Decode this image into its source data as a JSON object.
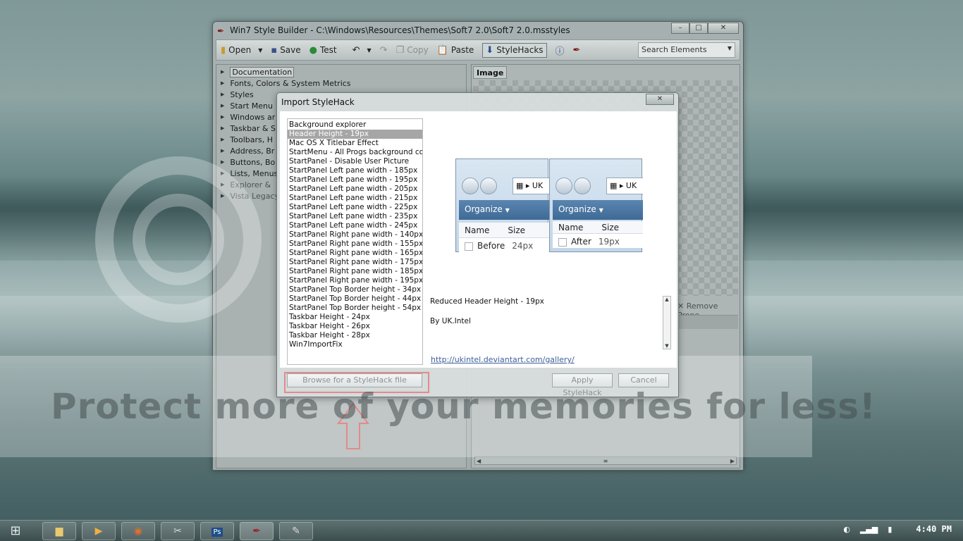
{
  "window": {
    "title": "Win7 Style Builder - C:\\Windows\\Resources\\Themes\\Soft7 2.0\\Soft7 2.0.msstyles",
    "minimize_glyph": "–",
    "maximize_glyph": "□",
    "close_glyph": "✕"
  },
  "toolbar": {
    "open": "Open",
    "save": "Save",
    "test": "Test",
    "copy": "Copy",
    "paste": "Paste",
    "stylehacks": "StyleHacks",
    "search_placeholder": "Search Elements"
  },
  "tree": {
    "items": [
      {
        "label": "Documentation"
      },
      {
        "label": "Fonts, Colors & System Metrics"
      },
      {
        "label": "Styles"
      },
      {
        "label": "Start Menu"
      },
      {
        "label": "Windows ar"
      },
      {
        "label": "Taskbar & S"
      },
      {
        "label": "Toolbars, H"
      },
      {
        "label": "Address, Br"
      },
      {
        "label": "Buttons, Bo"
      },
      {
        "label": "Lists, Menus"
      },
      {
        "label": "Explorer &"
      },
      {
        "label": "Vista Legacy"
      }
    ]
  },
  "right_panel": {
    "tab_label": "Image",
    "remove_property": "Remove Prope"
  },
  "dialog": {
    "title": "Import StyleHack",
    "close_glyph": "✕",
    "hacks": [
      "Background explorer",
      "Header Height - 19px",
      "Mac OS X Titlebar Effect",
      "StartMenu - All Progs background color",
      "StartPanel - Disable User Picture",
      "StartPanel Left pane width - 185px",
      "StartPanel Left pane width - 195px",
      "StartPanel Left pane width - 205px",
      "StartPanel Left pane width - 215px",
      "StartPanel Left pane width - 225px",
      "StartPanel Left pane width - 235px",
      "StartPanel Left pane width - 245px",
      "StartPanel Right pane width - 140px",
      "StartPanel Right pane width - 155px",
      "StartPanel Right pane width - 165px",
      "StartPanel Right pane width - 175px",
      "StartPanel Right pane width - 185px",
      "StartPanel Right pane width - 195px",
      "StartPanel Top Border height - 34px",
      "StartPanel Top Border height - 44px",
      "StartPanel Top Border height - 54px",
      "Taskbar Height - 24px",
      "Taskbar Height - 26px",
      "Taskbar Height - 28px",
      "Win7ImportFix"
    ],
    "selected_hack": "Header Height - 19px",
    "preview": {
      "before": {
        "addr": "UK",
        "organize": "Organize",
        "col_name": "Name",
        "col_size": "Size",
        "row_label": "Before",
        "row_size": "24px"
      },
      "after": {
        "addr": "UK",
        "organize": "Organize",
        "col_name": "Name",
        "col_size": "Size",
        "row_label": "After",
        "row_size": "19px"
      }
    },
    "description": "Reduced Header Height - 19px",
    "author": "By UK.Intel",
    "link": "http://ukintel.deviantart.com/gallery/",
    "browse_button": "Browse for a StyleHack file",
    "apply_button": "Apply StyleHack",
    "cancel_button": "Cancel"
  },
  "watermark": {
    "text": "Protect more of your memories for less!"
  },
  "taskbar": {
    "clock": "4:40 PM",
    "ps_label": "Ps"
  },
  "colors": {
    "highlight_border": "#e28b8b",
    "selection_bg": "#a6a6a6",
    "link": "#3d5f9a",
    "explorer_cmdbar": "#4a76a2"
  }
}
